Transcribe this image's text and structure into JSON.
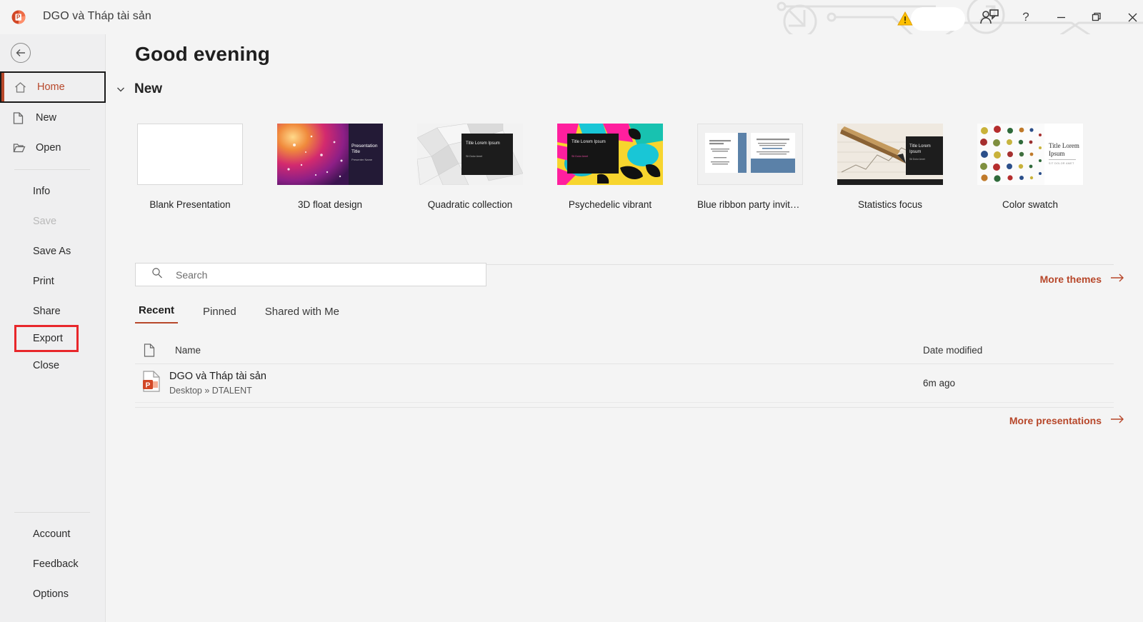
{
  "titlebar": {
    "app_icon": "powerpoint-logo-icon",
    "document_title": "DGO và Tháp tài sản",
    "warning_icon": "warning-triangle-icon",
    "share_icon": "share-person-icon",
    "help_label": "?",
    "minimize_label": "minimize-icon",
    "maximize_label": "restore-icon",
    "close_label": "close-icon"
  },
  "sidebar": {
    "back_label": "back-arrow-icon",
    "items": [
      {
        "label": "Home",
        "icon": "home-icon",
        "state": "active"
      },
      {
        "label": "New",
        "icon": "page-icon",
        "state": "normal"
      },
      {
        "label": "Open",
        "icon": "folder-icon",
        "state": "normal"
      }
    ],
    "items2": [
      {
        "label": "Info",
        "state": "normal"
      },
      {
        "label": "Save",
        "state": "disabled"
      },
      {
        "label": "Save As",
        "state": "normal"
      },
      {
        "label": "Print",
        "state": "normal"
      },
      {
        "label": "Share",
        "state": "normal"
      },
      {
        "label": "Export",
        "state": "highlighted"
      },
      {
        "label": "Close",
        "state": "normal"
      }
    ],
    "items3": [
      {
        "label": "Account",
        "state": "normal"
      },
      {
        "label": "Feedback",
        "state": "normal"
      },
      {
        "label": "Options",
        "state": "normal"
      }
    ]
  },
  "main": {
    "greeting": "Good evening",
    "new_section": {
      "label": "New",
      "chevron": "chevron-down-icon",
      "themes": [
        {
          "name": "Blank Presentation",
          "thumb": "blank"
        },
        {
          "name": "3D float design",
          "thumb": "float3d"
        },
        {
          "name": "Quadratic collection",
          "thumb": "quadratic"
        },
        {
          "name": "Psychedelic vibrant",
          "thumb": "psychedelic"
        },
        {
          "name": "Blue ribbon party invitation...",
          "thumb": "blueribbon"
        },
        {
          "name": "Statistics focus",
          "thumb": "statistics"
        },
        {
          "name": "Color swatch",
          "thumb": "colorswatch"
        }
      ],
      "more_themes_label": "More themes",
      "more_themes_arrow": "arrow-right-icon"
    },
    "search": {
      "placeholder": "Search",
      "value": "",
      "icon": "search-icon"
    },
    "tabs": [
      {
        "label": "Recent",
        "active": true
      },
      {
        "label": "Pinned",
        "active": false
      },
      {
        "label": "Shared with Me",
        "active": false
      }
    ],
    "list": {
      "columns": {
        "name": "Name",
        "date": "Date modified",
        "icon": "document-icon"
      },
      "rows": [
        {
          "icon": "powerpoint-file-icon",
          "name": "DGO và Tháp tài sản",
          "path": "Desktop » DTALENT",
          "date": "6m ago"
        }
      ],
      "more_presentations_label": "More presentations",
      "more_presentations_arrow": "arrow-right-icon"
    }
  },
  "theme_titles": {
    "float3d_title": "Presentation Title",
    "float3d_sub": "Presenter Name",
    "lorem_title": "Title Lorem Ipsum",
    "lorem_sub": "Sit Dolor Amet",
    "colorswatch_title": "Title Lorem Ipsum",
    "colorswatch_sub": "SIT DOLOR AMET"
  },
  "colors": {
    "accent": "#b7472a",
    "annotation": "#e8272b",
    "sidebar_bg": "#efeff0",
    "main_bg": "#f4f4f4"
  }
}
